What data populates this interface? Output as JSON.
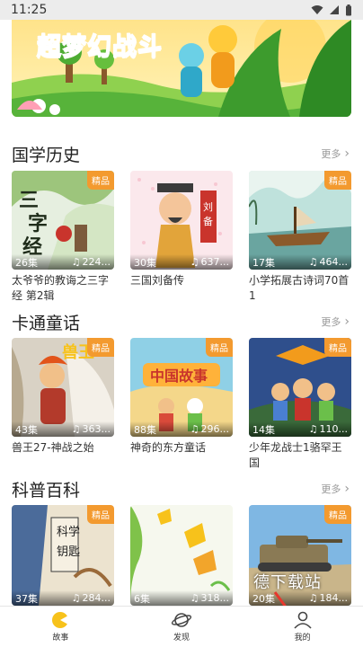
{
  "status_bar": {
    "time": "11:25"
  },
  "banner": {
    "title": "超梦幻战斗"
  },
  "sections": [
    {
      "title": "国学历史",
      "more": "更多",
      "items": [
        {
          "title": "太爷爷的教诲之三字经 第2辑",
          "badge": "精品",
          "episodes": "26集",
          "plays": "224..."
        },
        {
          "title": "三国刘备传",
          "badge": "",
          "episodes": "30集",
          "plays": "637..."
        },
        {
          "title": "小学拓展古诗词70首 1",
          "badge": "精品",
          "episodes": "17集",
          "plays": "464..."
        }
      ]
    },
    {
      "title": "卡通童话",
      "more": "更多",
      "items": [
        {
          "title": "兽王27-神战之始",
          "badge": "精品",
          "episodes": "43集",
          "plays": "363..."
        },
        {
          "title": "神奇的东方童话",
          "badge": "精品",
          "episodes": "88集",
          "plays": "296..."
        },
        {
          "title": "少年龙战士1骆罕王国",
          "badge": "精品",
          "episodes": "14集",
          "plays": "110..."
        }
      ]
    },
    {
      "title": "科普百科",
      "more": "更多",
      "items": [
        {
          "title": "",
          "badge": "精品",
          "episodes": "37集",
          "plays": "284..."
        },
        {
          "title": "",
          "badge": "",
          "episodes": "6集",
          "plays": "318..."
        },
        {
          "title": "",
          "badge": "精品",
          "episodes": "20集",
          "plays": "184..."
        }
      ]
    }
  ],
  "watermark": "德下载站",
  "tabbar": [
    {
      "label": "故事",
      "icon": "story-icon",
      "active": true
    },
    {
      "label": "发现",
      "icon": "planet-icon",
      "active": false
    },
    {
      "label": "我的",
      "icon": "user-icon",
      "active": false
    }
  ],
  "colors": {
    "accent": "#f7c21b",
    "badge": "#f39a2f"
  }
}
